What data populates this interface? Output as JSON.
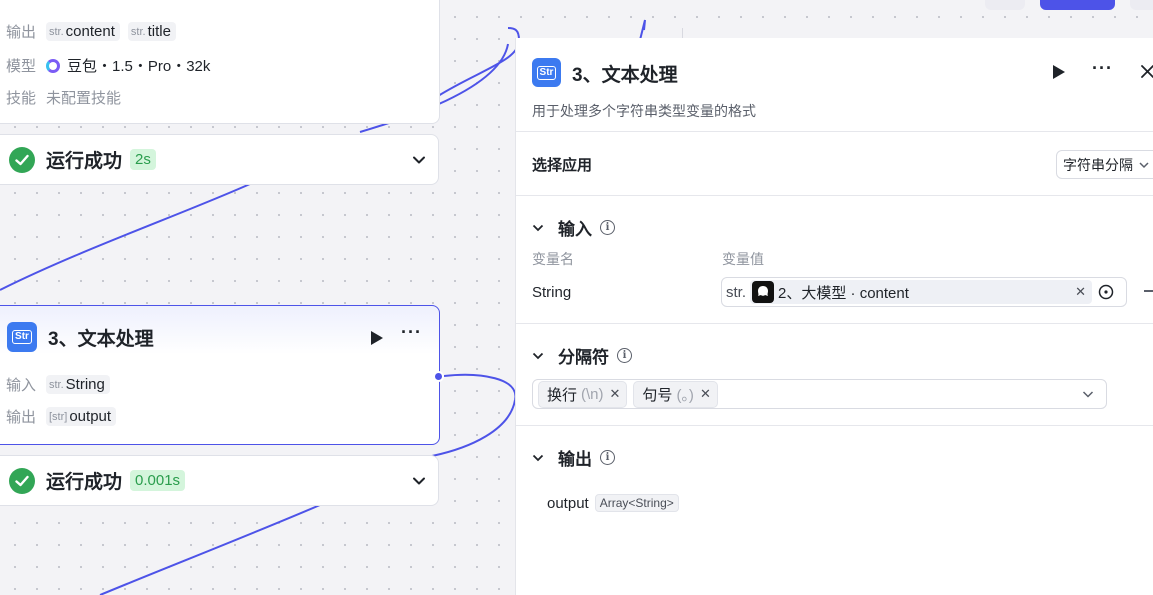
{
  "top_bar": {},
  "canvas": {
    "llm_node": {
      "output_label": "输出",
      "output_vars": [
        {
          "tag": "str.",
          "name": "content"
        },
        {
          "tag": "str.",
          "name": "title"
        }
      ],
      "model_label": "模型",
      "model_value": "豆包・1.5・Pro・32k",
      "skill_label": "技能",
      "skill_value": "未配置技能"
    },
    "run1": {
      "status": "运行成功",
      "time": "2s"
    },
    "text_node": {
      "icon_text": "Str",
      "title": "3、文本处理",
      "input_label": "输入",
      "input_tag": "str.",
      "input_value": "String",
      "output_label": "输出",
      "output_tag": "[str]",
      "output_value": "output"
    },
    "run2": {
      "status": "运行成功",
      "time": "0.001s"
    }
  },
  "panel": {
    "icon_text": "Str",
    "title": "3、文本处理",
    "description": "用于处理多个字符串类型变量的格式",
    "select_app_label": "选择应用",
    "select_app_value": "字符串分隔",
    "input_section": {
      "title": "输入",
      "col_name": "变量名",
      "col_value": "变量值",
      "var_name": "String",
      "var_type_prefix": "str.",
      "var_ref": "2、大模型 · content"
    },
    "separator_section": {
      "title": "分隔符",
      "tags": [
        {
          "label": "换行",
          "sub": "(\\n)"
        },
        {
          "label": "句号",
          "sub": "(。)"
        }
      ]
    },
    "output_section": {
      "title": "输出",
      "var_name": "output",
      "var_type": "Array<String>"
    }
  },
  "colors": {
    "accent": "#4d53e8",
    "success": "#32a656",
    "success_bg": "#d4f5dc",
    "str_icon": "#3c7af0"
  }
}
